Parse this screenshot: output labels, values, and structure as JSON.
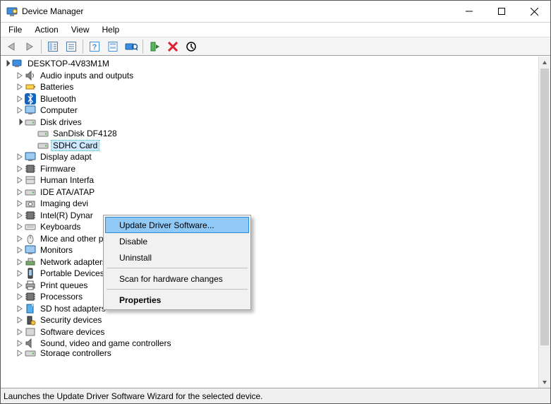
{
  "window": {
    "title": "Device Manager"
  },
  "menu": {
    "file": "File",
    "action": "Action",
    "view": "View",
    "help": "Help"
  },
  "toolbar": {
    "back": "Back",
    "forward": "Forward",
    "show_hide_tree": "Show/Hide Console Tree",
    "properties": "Properties",
    "help": "Help",
    "update_driver": "Update Driver Software",
    "scan": "Scan for hardware changes",
    "uninstall": "Uninstall",
    "disable": "Disable",
    "enable": "Enable"
  },
  "tree": {
    "root": "DESKTOP-4V83M1M",
    "items": [
      {
        "id": "audio",
        "label": "Audio inputs and outputs",
        "expandable": true
      },
      {
        "id": "batteries",
        "label": "Batteries",
        "expandable": true
      },
      {
        "id": "bluetooth",
        "label": "Bluetooth",
        "expandable": true
      },
      {
        "id": "computer",
        "label": "Computer",
        "expandable": true
      },
      {
        "id": "disk",
        "label": "Disk drives",
        "expandable": true,
        "expanded": true,
        "children": [
          {
            "id": "sandisk",
            "label": "SanDisk DF4128"
          },
          {
            "id": "sdhc",
            "label": "SDHC Card",
            "selected": true
          }
        ]
      },
      {
        "id": "display",
        "label": "Display adapt",
        "expandable": true,
        "truncated": true
      },
      {
        "id": "firmware",
        "label": "Firmware",
        "expandable": true
      },
      {
        "id": "hid",
        "label": "Human Interfa",
        "expandable": true,
        "truncated": true
      },
      {
        "id": "ide",
        "label": "IDE ATA/ATAP",
        "expandable": true,
        "truncated": true
      },
      {
        "id": "imaging",
        "label": "Imaging devi",
        "expandable": true,
        "truncated": true
      },
      {
        "id": "intel",
        "label": "Intel(R) Dynar",
        "expandable": true,
        "truncated": true
      },
      {
        "id": "keyboards",
        "label": "Keyboards",
        "expandable": true
      },
      {
        "id": "mice",
        "label": "Mice and other pointing devices",
        "expandable": true
      },
      {
        "id": "monitors",
        "label": "Monitors",
        "expandable": true
      },
      {
        "id": "network",
        "label": "Network adapters",
        "expandable": true
      },
      {
        "id": "portable",
        "label": "Portable Devices",
        "expandable": true
      },
      {
        "id": "printq",
        "label": "Print queues",
        "expandable": true
      },
      {
        "id": "processors",
        "label": "Processors",
        "expandable": true
      },
      {
        "id": "sdhost",
        "label": "SD host adapters",
        "expandable": true
      },
      {
        "id": "security",
        "label": "Security devices",
        "expandable": true
      },
      {
        "id": "software",
        "label": "Software devices",
        "expandable": true
      },
      {
        "id": "sound",
        "label": "Sound, video and game controllers",
        "expandable": true
      },
      {
        "id": "storage",
        "label": "Storage controllers",
        "expandable": true,
        "cutoff": true
      }
    ]
  },
  "context_menu": {
    "update": "Update Driver Software...",
    "disable": "Disable",
    "uninstall": "Uninstall",
    "scan": "Scan for hardware changes",
    "properties": "Properties"
  },
  "status": "Launches the Update Driver Software Wizard for the selected device."
}
